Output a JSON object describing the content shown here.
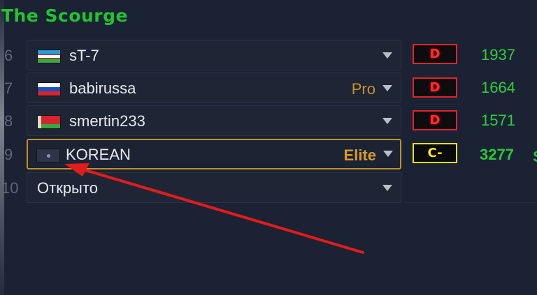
{
  "team": {
    "title": "The Scourge"
  },
  "slots": [
    {
      "num": "6",
      "name": "sT-7",
      "tier": "",
      "flag": "uzbekistan-flag",
      "rank": "D",
      "rating": "1937"
    },
    {
      "num": "7",
      "name": "babirussa",
      "tier": "Pro",
      "flag": "russia-flag",
      "rank": "D",
      "rating": "1664"
    },
    {
      "num": "8",
      "name": "smertin233",
      "tier": "",
      "flag": "belarus-flag",
      "rank": "D",
      "rating": "1571"
    },
    {
      "num": "9",
      "name": "KOREAN",
      "tier": "Elite",
      "flag": "south-korea-flag",
      "rank": "C-",
      "rating": "3277"
    },
    {
      "num": "10",
      "name": "Открыто",
      "tier": "",
      "flag": "",
      "rank": "",
      "rating": ""
    }
  ],
  "cut_text": "S",
  "colors": {
    "background": "#1a2233",
    "title": "#23c232",
    "rating": "#2fcf3b",
    "highlight": "#c58f2a",
    "arrow": "#e01c1c"
  }
}
